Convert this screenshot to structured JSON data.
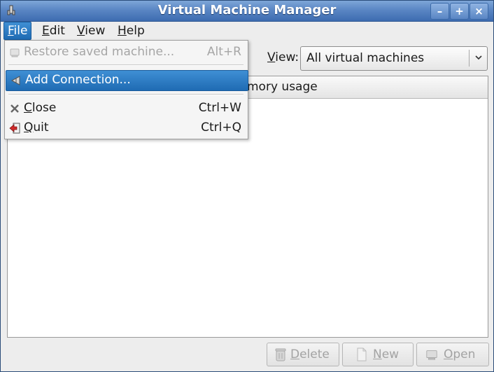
{
  "window": {
    "title": "Virtual Machine Manager",
    "controls": {
      "minimize": "–",
      "maximize": "+",
      "close": "×"
    }
  },
  "menubar": {
    "items": [
      {
        "label": "File",
        "mnemonic": "F",
        "rest": "ile",
        "active": true
      },
      {
        "label": "Edit",
        "mnemonic": "E",
        "rest": "dit"
      },
      {
        "label": "View",
        "mnemonic": "V",
        "rest": "iew"
      },
      {
        "label": "Help",
        "mnemonic": "H",
        "rest": "elp"
      }
    ]
  },
  "file_menu": {
    "items": [
      {
        "label": "Restore saved machine...",
        "accel": "Alt+R",
        "enabled": false,
        "icon": "restore-icon"
      },
      {
        "label": "Add Connection...",
        "accel": "",
        "enabled": true,
        "highlighted": true,
        "icon": "add-connection-icon"
      },
      {
        "label": "Close",
        "mnemonic": "C",
        "rest": "lose",
        "accel": "Ctrl+W",
        "enabled": true,
        "icon": "close-icon"
      },
      {
        "label": "Quit",
        "mnemonic": "Q",
        "rest": "uit",
        "accel": "Ctrl+Q",
        "enabled": true,
        "icon": "quit-icon"
      }
    ]
  },
  "toolbar": {
    "view_label_mnemonic": "V",
    "view_label_rest": "iew:",
    "view_selected": "All virtual machines"
  },
  "list": {
    "columns": [
      {
        "label": "mory usage"
      }
    ]
  },
  "buttons": {
    "delete": {
      "mnemonic": "D",
      "rest": "elete",
      "enabled": false
    },
    "new": {
      "mnemonic": "N",
      "rest": "ew",
      "enabled": false
    },
    "open": {
      "mnemonic": "O",
      "rest": "pen",
      "enabled": false
    }
  },
  "colors": {
    "titlebar": "#5a86c4",
    "highlight": "#2f7dc4",
    "disabled_text": "#a6a6a6"
  }
}
